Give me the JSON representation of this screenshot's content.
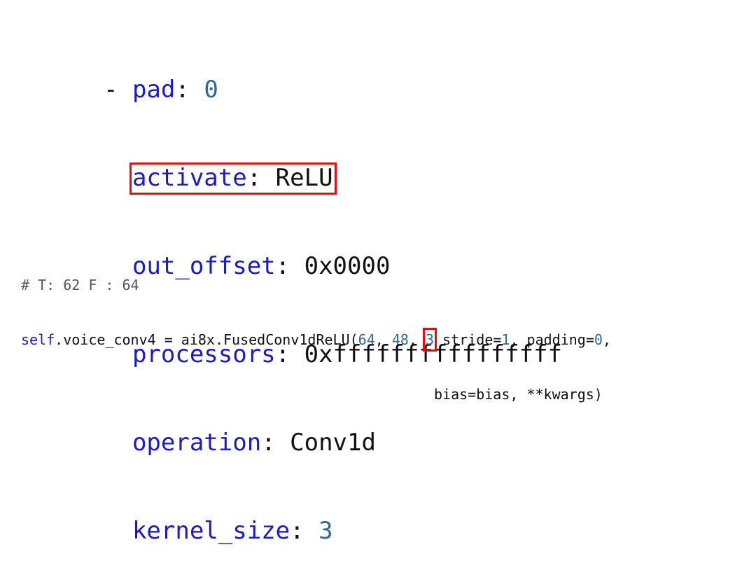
{
  "yaml": {
    "dash": "- ",
    "pad_key": "pad",
    "pad_value": "0",
    "activate_key": "activate",
    "activate_value": "ReLU",
    "out_offset_key": "out_offset",
    "out_offset_value": "0x0000",
    "processors_key": "processors",
    "processors_value": "0xffffffffffffffff",
    "operation_key": "operation",
    "operation_value": "Conv1d",
    "kernel_size_key": "kernel_size",
    "kernel_size_value": "3",
    "colon": ": "
  },
  "code": {
    "comment": "# T: 62 F : 64",
    "self_kw": "self",
    "line1_a": ".voice_conv4 = ai8x.FusedConv1dReLU(",
    "arg1": "64",
    "sep1": ", ",
    "arg2": "48",
    "sep2": ", ",
    "arg3": "3",
    "line1_b": " stride=",
    "stride": "1",
    "line1_c": ", padding=",
    "padding": "0",
    "line1_d": ",",
    "line2_indent": "                                                 ",
    "line2": "bias=bias, **kwargs)"
  },
  "colors": {
    "key": "#1a1ac8",
    "number": "#2f6a95",
    "highlight_border": "#e01010"
  }
}
